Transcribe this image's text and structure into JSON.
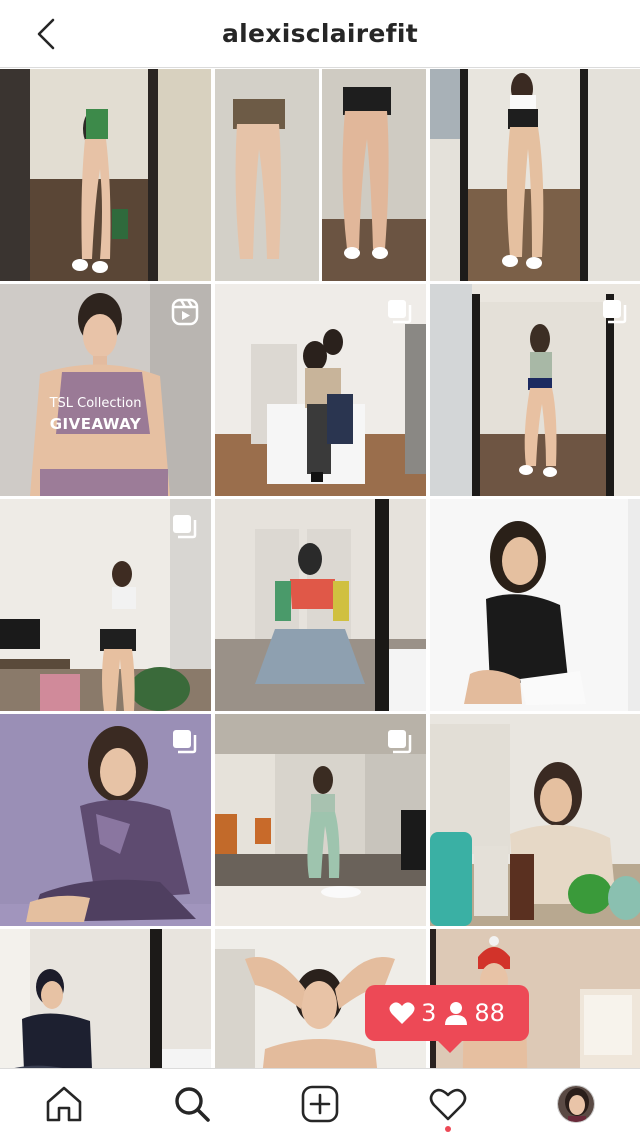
{
  "header": {
    "title": "alexisclairefit",
    "back_icon": "chevron-left-icon"
  },
  "grid": {
    "posts": [
      {
        "name": "post-mirror-selfie-green-top",
        "badge": ""
      },
      {
        "name": "post-shorts-comparison",
        "badge": ""
      },
      {
        "name": "post-mirror-selfie-white-top",
        "badge": ""
      },
      {
        "name": "post-tsl-collection-giveaway",
        "badge": "reel-icon",
        "overlay_line1": "TSL Collection",
        "overlay_line2": "GIVEAWAY"
      },
      {
        "name": "post-couple-kitchen",
        "badge": "multiple-icon"
      },
      {
        "name": "post-mirror-selfie-hallway",
        "badge": "multiple-icon"
      },
      {
        "name": "post-living-room",
        "badge": "multiple-icon"
      },
      {
        "name": "post-kneeling-mirror",
        "badge": ""
      },
      {
        "name": "post-black-hoodie",
        "badge": ""
      },
      {
        "name": "post-purple-tshirt",
        "badge": "multiple-icon"
      },
      {
        "name": "post-gym-locker-room",
        "badge": "multiple-icon"
      },
      {
        "name": "post-kitchen-groceries",
        "badge": ""
      },
      {
        "name": "post-sitting-floor",
        "badge": ""
      },
      {
        "name": "post-braids-sports-bra",
        "badge": ""
      },
      {
        "name": "post-bathroom-selfie",
        "badge": ""
      }
    ]
  },
  "notification": {
    "likes": "3",
    "followers": "88",
    "color": "#ed4956"
  },
  "tabbar": {
    "tabs": [
      "home-icon",
      "search-icon",
      "new-post-icon",
      "activity-icon",
      "profile-avatar"
    ]
  }
}
